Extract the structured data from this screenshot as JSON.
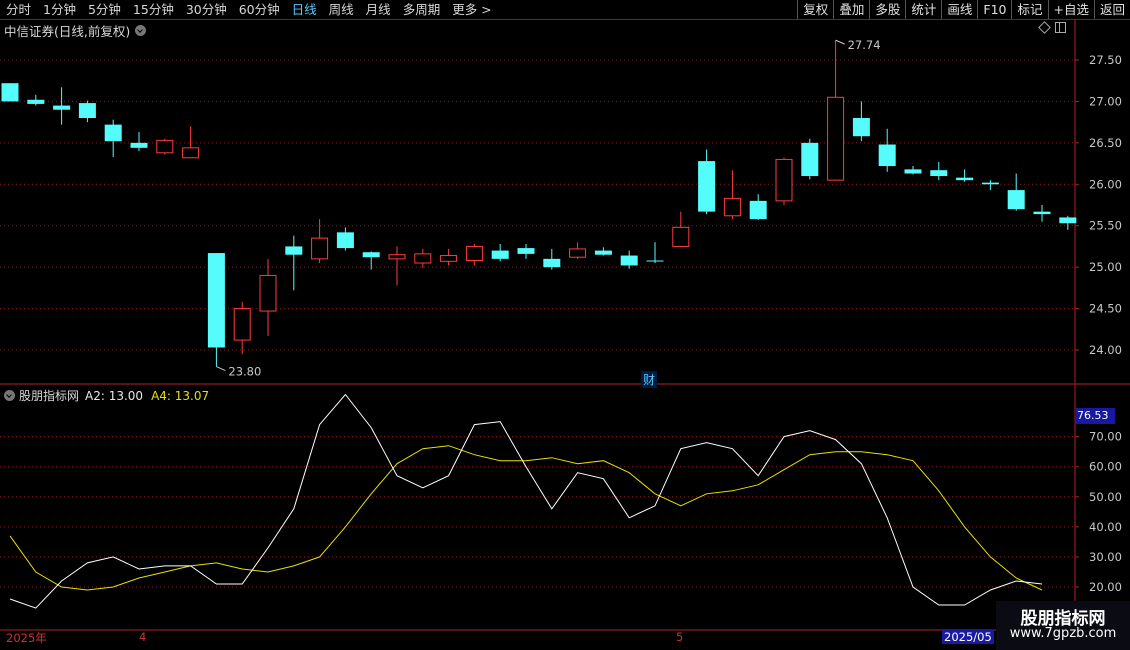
{
  "toolbar": {
    "periods": [
      "分时",
      "1分钟",
      "5分钟",
      "15分钟",
      "30分钟",
      "60分钟",
      "日线",
      "周线",
      "月线",
      "多周期",
      "更多 >"
    ],
    "active_period": "日线",
    "actions": [
      "复权",
      "叠加",
      "多股",
      "统计",
      "画线",
      "F10",
      "标记",
      "+自选",
      "返回"
    ]
  },
  "chart_title": "中信证券(日线,前复权)",
  "price_axis": [
    "27.50",
    "27.00",
    "26.50",
    "26.00",
    "25.50",
    "25.00",
    "24.50",
    "24.00"
  ],
  "max_label": "27.74",
  "min_label": "23.80",
  "finance_mark": "财",
  "indicator": {
    "name": "股朋指标网",
    "a2_label": "A2: 13.00",
    "a4_label": "A4: 13.07",
    "badge": "76.53",
    "axis": [
      "70.00",
      "60.00",
      "50.00",
      "40.00",
      "30.00",
      "20.00"
    ]
  },
  "dates": {
    "d1": "2025年",
    "d2": "4",
    "d3": "5",
    "d4": "2025/05"
  },
  "watermark": {
    "title": "股朋指标网",
    "url": "www.7gpzb.com"
  },
  "colors": {
    "up": "#ff3c3c",
    "down": "#54fcfc",
    "a2": "#ffffff",
    "a4": "#e8e000",
    "grid": "#8b1a1a"
  },
  "chart_data": {
    "type": "candlestick",
    "ylim": [
      23.65,
      27.9
    ],
    "candles": [
      [
        27.22,
        27.0,
        27.22,
        27.0
      ],
      [
        27.02,
        26.97,
        27.08,
        26.95
      ],
      [
        26.95,
        26.9,
        27.17,
        26.72
      ],
      [
        26.98,
        26.8,
        27.01,
        26.75
      ],
      [
        26.72,
        26.52,
        26.78,
        26.33
      ],
      [
        26.5,
        26.44,
        26.63,
        26.4
      ],
      [
        26.38,
        26.53,
        26.55,
        26.36
      ],
      [
        26.32,
        26.44,
        26.7,
        26.32
      ],
      [
        25.17,
        24.03,
        25.17,
        23.8
      ],
      [
        24.12,
        24.5,
        24.58,
        23.95
      ],
      [
        24.47,
        24.9,
        25.1,
        24.17
      ],
      [
        25.25,
        25.15,
        25.38,
        24.72
      ],
      [
        25.1,
        25.35,
        25.58,
        25.05
      ],
      [
        25.42,
        25.23,
        25.48,
        25.2
      ],
      [
        25.18,
        25.12,
        25.19,
        24.97
      ],
      [
        25.1,
        25.15,
        25.25,
        24.78
      ],
      [
        25.05,
        25.16,
        25.22,
        24.99
      ],
      [
        25.07,
        25.14,
        25.22,
        25.02
      ],
      [
        25.08,
        25.25,
        25.28,
        25.02
      ],
      [
        25.2,
        25.1,
        25.28,
        25.07
      ],
      [
        25.23,
        25.16,
        25.28,
        25.1
      ],
      [
        25.1,
        25.0,
        25.22,
        24.97
      ],
      [
        25.12,
        25.22,
        25.3,
        25.1
      ],
      [
        25.2,
        25.15,
        25.24,
        25.14
      ],
      [
        25.14,
        25.02,
        25.2,
        24.98
      ],
      [
        25.08,
        25.08,
        25.3,
        25.05
      ],
      [
        25.25,
        25.48,
        25.67,
        25.25
      ],
      [
        26.28,
        25.67,
        26.42,
        25.64
      ],
      [
        25.62,
        25.83,
        26.17,
        25.58
      ],
      [
        25.8,
        25.58,
        25.88,
        25.57
      ],
      [
        25.8,
        26.3,
        26.32,
        25.75
      ],
      [
        26.5,
        26.1,
        26.55,
        26.06
      ],
      [
        26.05,
        27.05,
        27.74,
        26.05
      ],
      [
        26.8,
        26.58,
        27.0,
        26.52
      ],
      [
        26.48,
        26.22,
        26.67,
        26.15
      ],
      [
        26.18,
        26.13,
        26.22,
        26.12
      ],
      [
        26.17,
        26.1,
        26.27,
        26.05
      ],
      [
        26.08,
        26.05,
        26.18,
        26.03
      ],
      [
        26.02,
        26.0,
        26.05,
        25.93
      ],
      [
        25.93,
        25.7,
        26.13,
        25.68
      ],
      [
        25.67,
        25.64,
        25.75,
        25.55
      ],
      [
        25.6,
        25.53,
        25.62,
        25.45
      ]
    ],
    "a2": [
      16,
      13,
      22,
      28,
      30,
      26,
      27,
      27,
      21,
      21,
      33,
      46,
      74,
      84,
      73,
      57,
      53,
      57,
      74,
      75,
      60,
      46,
      58,
      56,
      43,
      47,
      66,
      68,
      66,
      57,
      70,
      72,
      69,
      61,
      43,
      20,
      14,
      14,
      19,
      22,
      21
    ],
    "a4": [
      37,
      25,
      20,
      19,
      20,
      23,
      25,
      27,
      28,
      26,
      25,
      27,
      30,
      40,
      51,
      61,
      66,
      67,
      64,
      62,
      62,
      63,
      61,
      62,
      58,
      51,
      47,
      51,
      52,
      54,
      59,
      64,
      65,
      65,
      64,
      62,
      52,
      40,
      30,
      23,
      19
    ],
    "a_ylim": [
      10,
      87
    ]
  }
}
